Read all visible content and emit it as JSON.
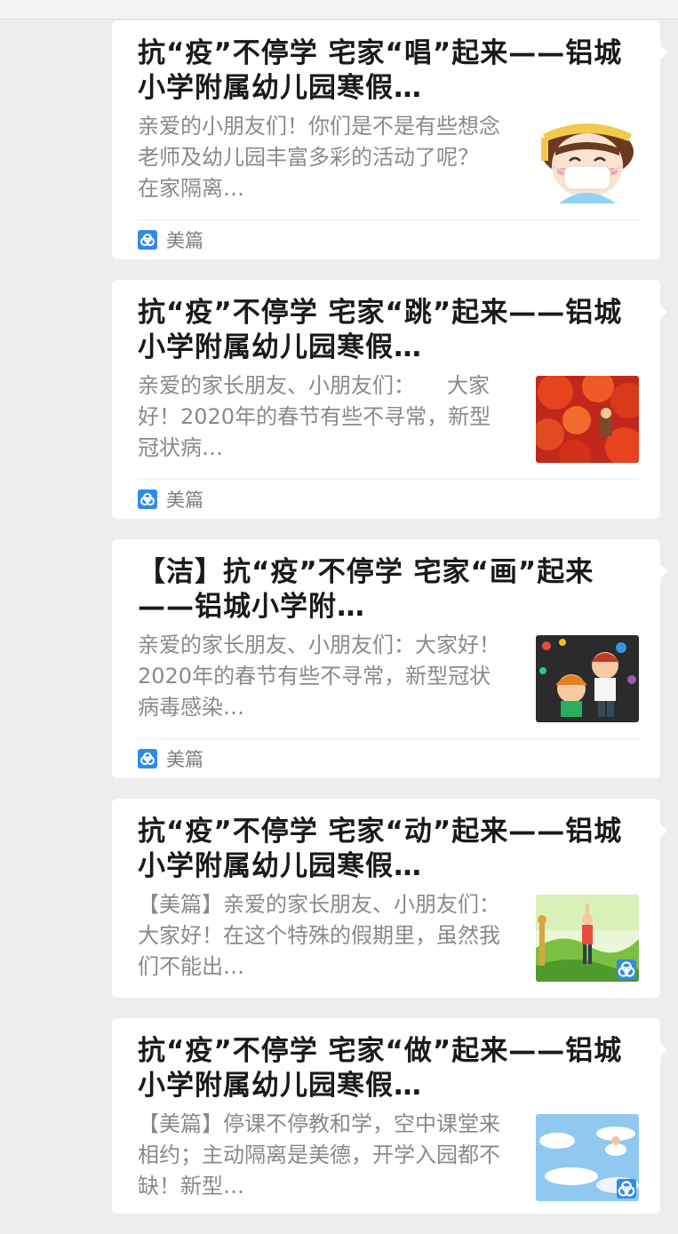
{
  "articles": [
    {
      "title": "抗“疫”不停学 宅家“唱”起来——铝城小学附属幼儿园寒假…",
      "summary": "亲爱的小朋友们！你们是不是有些想念老师及幼儿园丰富多彩的活动了呢？　在家隔离…",
      "source": "美篇",
      "thumb_icon": "girl-with-mask-illustration"
    },
    {
      "title": "抗“疫”不停学 宅家“跳”起来——铝城小学附属幼儿园寒假…",
      "summary": "亲爱的家长朋友、小朋友们：　　大家好！2020年的春节有些不寻常，新型冠状病…",
      "source": "美篇",
      "thumb_icon": "red-lanterns-photo"
    },
    {
      "title": "【洁】抗“疫”不停学 宅家“画”起来——铝城小学附…",
      "summary": "亲爱的家长朋友、小朋友们：大家好！2020年的春节有些不寻常，新型冠状病毒感染…",
      "source": "美篇",
      "thumb_icon": "kids-painting-illustration"
    },
    {
      "title": "抗“疫”不停学 宅家“动”起来——铝城小学附属幼儿园寒假…",
      "summary": "【美篇】亲爱的家长朋友、小朋友们：大家好！在这个特殊的假期里，虽然我们不能出…",
      "source": "",
      "thumb_icon": "child-exercising-outdoors"
    },
    {
      "title": "抗“疫”不停学 宅家“做”起来——铝城小学附属幼儿园寒假…",
      "summary": "【美篇】停课不停教和学，空中课堂来相约；主动隔离是美德，开学入园都不缺！新型…",
      "source": "",
      "thumb_icon": "sky-clouds-illustration"
    }
  ],
  "colors": {
    "background": "#ededed",
    "card": "#ffffff",
    "title": "#1a1a1a",
    "summary": "#8a8a8a",
    "source_icon": "#2f8bea"
  }
}
